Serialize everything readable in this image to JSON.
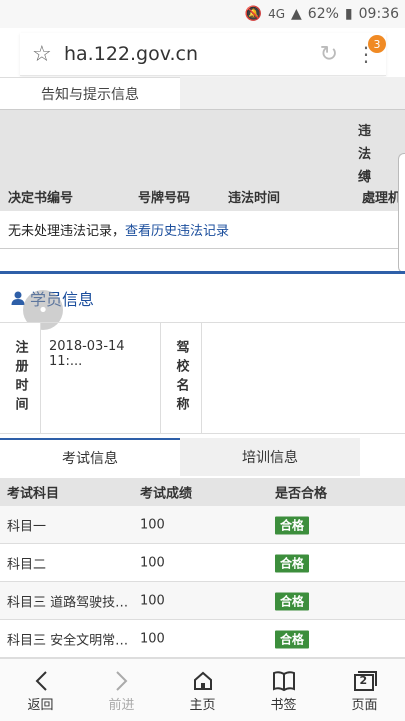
{
  "status_bar": {
    "signal_label": "4G",
    "battery": "62%",
    "time": "09:36"
  },
  "browser": {
    "url": "ha.122.gov.cn",
    "tab_count_badge": "3"
  },
  "notice": {
    "tab_label": "告知与提示信息",
    "columns": {
      "decision_no": "决定书编号",
      "plate_no": "号牌号码",
      "violation_time": "违法时间",
      "violation_cont": "违法缚",
      "handling": "處理机关"
    },
    "empty_text": "无未处理违法记录，",
    "history_link": "查看历史违法记录"
  },
  "student": {
    "title": "学员信息",
    "reg_time_label": "注册时间",
    "reg_time_value": "2018-03-14 11:...",
    "school_label": "驾校名称",
    "school_value": ""
  },
  "tabs": [
    {
      "label": "考试信息"
    },
    {
      "label": "培训信息"
    }
  ],
  "exam": {
    "headers": [
      "考试科目",
      "考试成绩",
      "是否合格"
    ],
    "rows": [
      {
        "subject": "科目一",
        "score": "100",
        "result": "合格"
      },
      {
        "subject": "科目二",
        "score": "100",
        "result": "合格"
      },
      {
        "subject": "科目三 道路驾驶技能...",
        "score": "100",
        "result": "合格"
      },
      {
        "subject": "科目三 安全文明常识...",
        "score": "100",
        "result": "合格"
      }
    ]
  },
  "bottom_nav": {
    "back": "返回",
    "forward": "前进",
    "home": "主页",
    "bookmarks": "书签",
    "pages": "页面",
    "pages_count": "2"
  }
}
